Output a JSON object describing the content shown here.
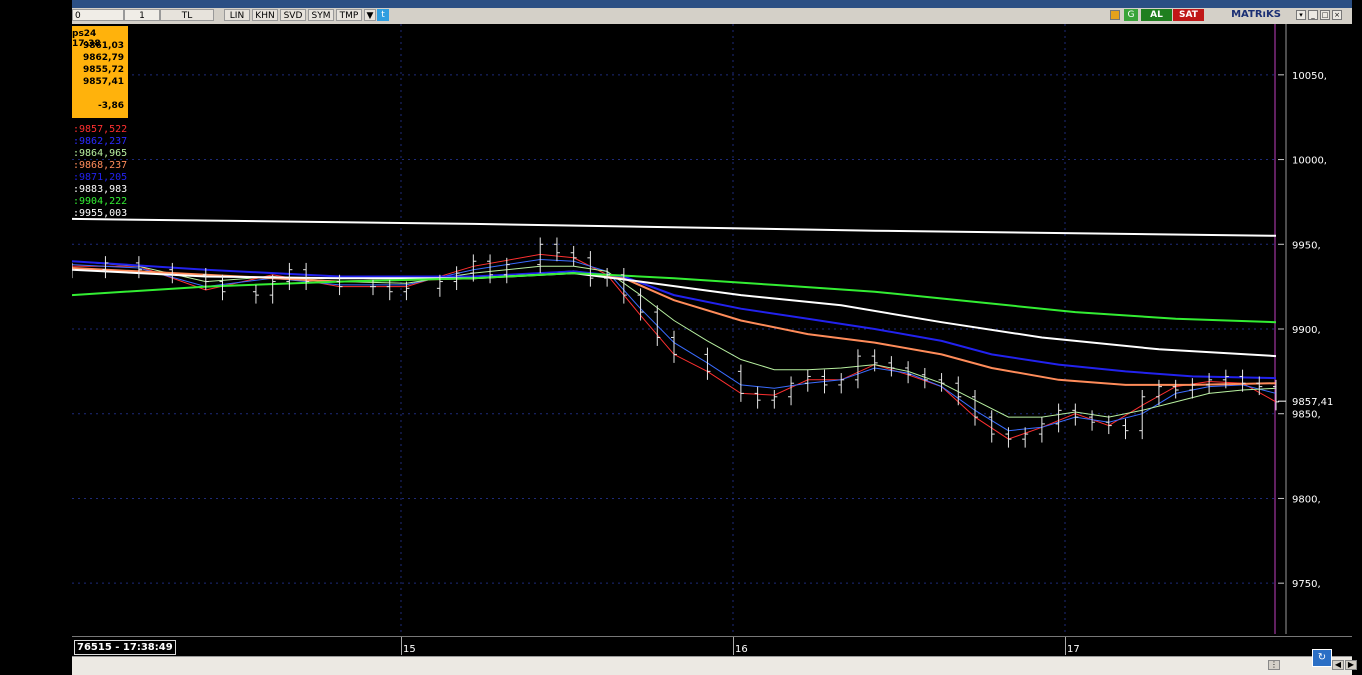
{
  "toolbar": {
    "cells": [
      "0",
      "1",
      "TL",
      "LIN",
      "KHN",
      "SVD",
      "SYM",
      "TMP",
      "▼"
    ],
    "brand": "MATRıKS",
    "buy_label": "AL",
    "sell_label": "SAT",
    "g_label": "G",
    "top_brand": "MATRıKS"
  },
  "infobox": {
    "header": "ps24 17:38",
    "values": [
      "9861,03",
      "9862,79",
      "9855,72",
      "9857,41"
    ],
    "change": "-3,86"
  },
  "ma_values": [
    {
      "text": ":9857,522",
      "color": "#ff3030"
    },
    {
      "text": ":9862,237",
      "color": "#2a2aff"
    },
    {
      "text": ":9864,965",
      "color": "#b8f0a0"
    },
    {
      "text": ":9868,237",
      "color": "#ff8c5a"
    },
    {
      "text": ":9871,205",
      "color": "#2222ee"
    },
    {
      "text": ":9883,983",
      "color": "#ffffff"
    },
    {
      "text": ":9904,222",
      "color": "#33ee33"
    },
    {
      "text": ":9955,003",
      "color": "#ffffff"
    }
  ],
  "status": {
    "text": "76515 - 17:38:49"
  },
  "chart_data": {
    "type": "line",
    "subtype": "ohlc-bars-with-moving-averages",
    "ylim": [
      9720,
      10080
    ],
    "y_ticks": [
      "10050,",
      "10000,",
      "9950,",
      "9900,",
      "9850,",
      "9800,",
      "9750,"
    ],
    "x_day_labels": [
      "15",
      "16",
      "17"
    ],
    "last_price_label": "9857,41",
    "last_price": 9857.41,
    "grid": true,
    "background": "#000000",
    "price_bar_color": "#e8e8e8",
    "price_path": [
      [
        0,
        9935
      ],
      [
        4,
        9939
      ],
      [
        8,
        9935
      ],
      [
        12,
        9932
      ],
      [
        16,
        9928
      ],
      [
        18,
        9922
      ],
      [
        22,
        9920
      ],
      [
        24,
        9928
      ],
      [
        26,
        9935
      ],
      [
        28,
        9928
      ],
      [
        32,
        9925
      ],
      [
        36,
        9925
      ],
      [
        38,
        9922
      ],
      [
        40,
        9924
      ],
      [
        44,
        9928
      ],
      [
        46,
        9933
      ],
      [
        48,
        9940
      ],
      [
        50,
        9932
      ],
      [
        52,
        9938
      ],
      [
        56,
        9950
      ],
      [
        58,
        9945
      ],
      [
        60,
        9942
      ],
      [
        62,
        9930
      ],
      [
        64,
        9932
      ],
      [
        66,
        9920
      ],
      [
        68,
        9910
      ],
      [
        70,
        9895
      ],
      [
        72,
        9885
      ],
      [
        76,
        9875
      ],
      [
        80,
        9862
      ],
      [
        82,
        9858
      ],
      [
        84,
        9860
      ],
      [
        86,
        9868
      ],
      [
        88,
        9872
      ],
      [
        90,
        9867
      ],
      [
        92,
        9870
      ],
      [
        94,
        9884
      ],
      [
        96,
        9880
      ],
      [
        98,
        9877
      ],
      [
        100,
        9873
      ],
      [
        102,
        9870
      ],
      [
        104,
        9868
      ],
      [
        106,
        9860
      ],
      [
        108,
        9848
      ],
      [
        110,
        9838
      ],
      [
        112,
        9835
      ],
      [
        114,
        9838
      ],
      [
        116,
        9844
      ],
      [
        118,
        9852
      ],
      [
        120,
        9848
      ],
      [
        122,
        9845
      ],
      [
        124,
        9843
      ],
      [
        126,
        9840
      ],
      [
        128,
        9860
      ],
      [
        130,
        9866
      ],
      [
        132,
        9864
      ],
      [
        134,
        9867
      ],
      [
        136,
        9870
      ],
      [
        138,
        9872
      ],
      [
        140,
        9868
      ],
      [
        142,
        9866
      ],
      [
        144,
        9857
      ]
    ],
    "series": [
      {
        "color": "#ff3030",
        "values": [
          [
            0,
            9937
          ],
          [
            8,
            9937
          ],
          [
            16,
            9923
          ],
          [
            24,
            9932
          ],
          [
            32,
            9925
          ],
          [
            40,
            9925
          ],
          [
            48,
            9937
          ],
          [
            56,
            9944
          ],
          [
            60,
            9942
          ],
          [
            64,
            9932
          ],
          [
            68,
            9908
          ],
          [
            72,
            9885
          ],
          [
            76,
            9875
          ],
          [
            80,
            9862
          ],
          [
            84,
            9861
          ],
          [
            88,
            9870
          ],
          [
            92,
            9870
          ],
          [
            96,
            9879
          ],
          [
            100,
            9873
          ],
          [
            104,
            9866
          ],
          [
            108,
            9848
          ],
          [
            112,
            9835
          ],
          [
            116,
            9842
          ],
          [
            120,
            9850
          ],
          [
            124,
            9843
          ],
          [
            128,
            9855
          ],
          [
            132,
            9866
          ],
          [
            136,
            9869
          ],
          [
            140,
            9868
          ],
          [
            144,
            9857
          ]
        ]
      },
      {
        "color": "#3a6cff",
        "values": [
          [
            0,
            9938
          ],
          [
            8,
            9936
          ],
          [
            16,
            9925
          ],
          [
            24,
            9930
          ],
          [
            32,
            9926
          ],
          [
            40,
            9926
          ],
          [
            48,
            9935
          ],
          [
            56,
            9941
          ],
          [
            60,
            9940
          ],
          [
            64,
            9934
          ],
          [
            68,
            9912
          ],
          [
            72,
            9892
          ],
          [
            76,
            9880
          ],
          [
            80,
            9867
          ],
          [
            84,
            9865
          ],
          [
            88,
            9868
          ],
          [
            92,
            9870
          ],
          [
            96,
            9877
          ],
          [
            100,
            9874
          ],
          [
            104,
            9866
          ],
          [
            108,
            9852
          ],
          [
            112,
            9840
          ],
          [
            116,
            9842
          ],
          [
            120,
            9848
          ],
          [
            124,
            9845
          ],
          [
            128,
            9850
          ],
          [
            132,
            9862
          ],
          [
            136,
            9866
          ],
          [
            140,
            9867
          ],
          [
            144,
            9862
          ]
        ]
      },
      {
        "color": "#b8f0a0",
        "values": [
          [
            0,
            9940
          ],
          [
            8,
            9937
          ],
          [
            16,
            9928
          ],
          [
            24,
            9931
          ],
          [
            32,
            9928
          ],
          [
            40,
            9927
          ],
          [
            48,
            9933
          ],
          [
            56,
            9937
          ],
          [
            60,
            9937
          ],
          [
            64,
            9934
          ],
          [
            68,
            9920
          ],
          [
            72,
            9905
          ],
          [
            76,
            9893
          ],
          [
            80,
            9882
          ],
          [
            84,
            9876
          ],
          [
            88,
            9876
          ],
          [
            92,
            9877
          ],
          [
            96,
            9879
          ],
          [
            100,
            9875
          ],
          [
            104,
            9868
          ],
          [
            108,
            9858
          ],
          [
            112,
            9848
          ],
          [
            116,
            9848
          ],
          [
            120,
            9851
          ],
          [
            124,
            9848
          ],
          [
            128,
            9852
          ],
          [
            132,
            9857
          ],
          [
            136,
            9862
          ],
          [
            140,
            9864
          ],
          [
            144,
            9865
          ]
        ]
      },
      {
        "color": "#ff8c5a",
        "values": [
          [
            0,
            9936
          ],
          [
            16,
            9932
          ],
          [
            32,
            9928
          ],
          [
            48,
            9930
          ],
          [
            60,
            9934
          ],
          [
            66,
            9930
          ],
          [
            72,
            9917
          ],
          [
            80,
            9905
          ],
          [
            88,
            9897
          ],
          [
            96,
            9892
          ],
          [
            104,
            9885
          ],
          [
            110,
            9877
          ],
          [
            118,
            9870
          ],
          [
            126,
            9867
          ],
          [
            134,
            9867
          ],
          [
            144,
            9868
          ]
        ]
      },
      {
        "color": "#2222ee",
        "values": [
          [
            0,
            9940
          ],
          [
            16,
            9935
          ],
          [
            32,
            9931
          ],
          [
            48,
            9931
          ],
          [
            60,
            9934
          ],
          [
            66,
            9931
          ],
          [
            72,
            9920
          ],
          [
            80,
            9912
          ],
          [
            88,
            9906
          ],
          [
            96,
            9900
          ],
          [
            104,
            9893
          ],
          [
            110,
            9885
          ],
          [
            118,
            9879
          ],
          [
            126,
            9875
          ],
          [
            134,
            9872
          ],
          [
            144,
            9871
          ]
        ]
      },
      {
        "color": "#ffffff",
        "values": [
          [
            0,
            9935
          ],
          [
            16,
            9931
          ],
          [
            32,
            9930
          ],
          [
            48,
            9930
          ],
          [
            60,
            9933
          ],
          [
            68,
            9928
          ],
          [
            80,
            9920
          ],
          [
            92,
            9914
          ],
          [
            104,
            9904
          ],
          [
            116,
            9895
          ],
          [
            130,
            9888
          ],
          [
            144,
            9884
          ]
        ]
      },
      {
        "color": "#33ee33",
        "values": [
          [
            0,
            9920
          ],
          [
            16,
            9925
          ],
          [
            32,
            9928
          ],
          [
            48,
            9930
          ],
          [
            60,
            9933
          ],
          [
            72,
            9930
          ],
          [
            84,
            9926
          ],
          [
            96,
            9922
          ],
          [
            108,
            9916
          ],
          [
            120,
            9910
          ],
          [
            132,
            9906
          ],
          [
            144,
            9904
          ]
        ]
      },
      {
        "color": "#ffffff",
        "values": [
          [
            0,
            9965
          ],
          [
            48,
            9962
          ],
          [
            96,
            9958
          ],
          [
            144,
            9955
          ]
        ]
      }
    ]
  }
}
